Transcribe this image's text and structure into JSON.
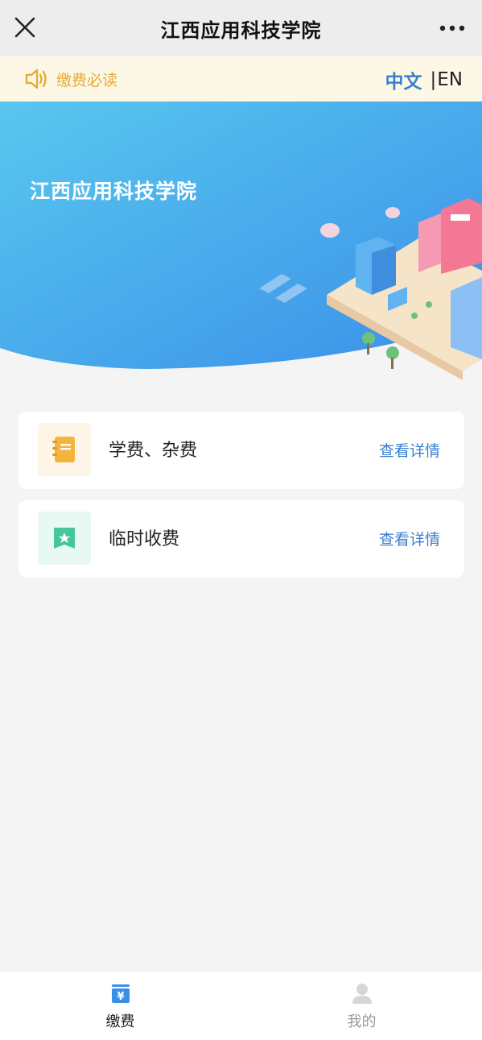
{
  "topbar": {
    "title": "江西应用科技学院"
  },
  "notice": {
    "text": "缴费必读",
    "lang_zh": "中文",
    "lang_sep": "|",
    "lang_en": "EN"
  },
  "banner": {
    "school_name": "江西应用科技学院"
  },
  "cards": [
    {
      "label": "学费、杂费",
      "detail": "查看详情",
      "icon": "notebook-icon"
    },
    {
      "label": "临时收费",
      "detail": "查看详情",
      "icon": "bookmark-star-icon"
    }
  ],
  "tabs": [
    {
      "label": "缴费",
      "icon": "payment-yen-icon",
      "active": true
    },
    {
      "label": "我的",
      "icon": "user-icon",
      "active": false
    }
  ],
  "colors": {
    "accent": "#3a7fcf",
    "notice_text": "#e8a93a",
    "notice_bg": "#fdf8e6",
    "card_icon_orange": "#f5b43a",
    "card_icon_green": "#46c79b"
  }
}
